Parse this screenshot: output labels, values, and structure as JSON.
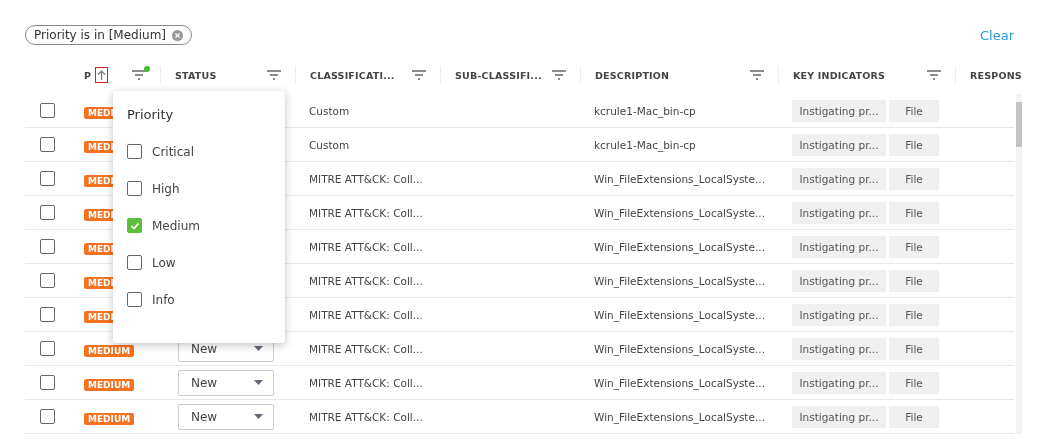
{
  "filter_chip": {
    "label": "Priority is in [Medium]"
  },
  "clear_link": "Clear",
  "columns": [
    {
      "label": "P",
      "sorted": true,
      "filter_active": true
    },
    {
      "label": "STATUS",
      "sorted": false
    },
    {
      "label": "CLASSIFICATI...",
      "sorted": false
    },
    {
      "label": "SUB-CLASSIFI...",
      "sorted": false
    },
    {
      "label": "DESCRIPTION",
      "sorted": false
    },
    {
      "label": "KEY INDICATORS",
      "sorted": false
    },
    {
      "label": "RESPONS",
      "sorted": false
    }
  ],
  "rows": [
    {
      "checked": false,
      "priority": "MEDI",
      "classification": "Custom",
      "description": "kcrule1-Mac_bin-cp",
      "indicators": [
        "Instigating pr...",
        "File"
      ]
    },
    {
      "checked": false,
      "priority": "MEDI",
      "classification": "Custom",
      "description": "kcrule1-Mac_bin-cp",
      "indicators": [
        "Instigating pr...",
        "File"
      ]
    },
    {
      "checked": false,
      "priority": "MEDI",
      "classification": "MITRE ATT&CK: Coll...",
      "description": "Win_FileExtensions_LocalSyste...",
      "indicators": [
        "Instigating pr...",
        "File"
      ]
    },
    {
      "checked": false,
      "priority": "MEDI",
      "classification": "MITRE ATT&CK: Coll...",
      "description": "Win_FileExtensions_LocalSyste...",
      "indicators": [
        "Instigating pr...",
        "File"
      ]
    },
    {
      "checked": false,
      "priority": "MEDI",
      "classification": "MITRE ATT&CK: Coll...",
      "description": "Win_FileExtensions_LocalSyste...",
      "indicators": [
        "Instigating pr...",
        "File"
      ]
    },
    {
      "checked": false,
      "priority": "MEDI",
      "classification": "MITRE ATT&CK: Coll...",
      "description": "Win_FileExtensions_LocalSyste...",
      "indicators": [
        "Instigating pr...",
        "File"
      ]
    },
    {
      "checked": false,
      "priority": "MEDI",
      "classification": "MITRE ATT&CK: Coll...",
      "description": "Win_FileExtensions_LocalSyste...",
      "indicators": [
        "Instigating pr...",
        "File"
      ]
    },
    {
      "checked": false,
      "priority": "MEDIUM",
      "status": "New",
      "classification": "MITRE ATT&CK: Coll...",
      "description": "Win_FileExtensions_LocalSyste...",
      "indicators": [
        "Instigating pr...",
        "File"
      ]
    },
    {
      "checked": false,
      "priority": "MEDIUM",
      "status": "New",
      "classification": "MITRE ATT&CK: Coll...",
      "description": "Win_FileExtensions_LocalSyste...",
      "indicators": [
        "Instigating pr...",
        "File"
      ]
    },
    {
      "checked": false,
      "priority": "MEDIUM",
      "status": "New",
      "classification": "MITRE ATT&CK: Coll...",
      "description": "Win_FileExtensions_LocalSyste...",
      "indicators": [
        "Instigating pr...",
        "File"
      ]
    }
  ],
  "priority_popup": {
    "title": "Priority",
    "options": [
      {
        "label": "Critical",
        "checked": false
      },
      {
        "label": "High",
        "checked": false
      },
      {
        "label": "Medium",
        "checked": true
      },
      {
        "label": "Low",
        "checked": false
      },
      {
        "label": "Info",
        "checked": false
      }
    ]
  }
}
